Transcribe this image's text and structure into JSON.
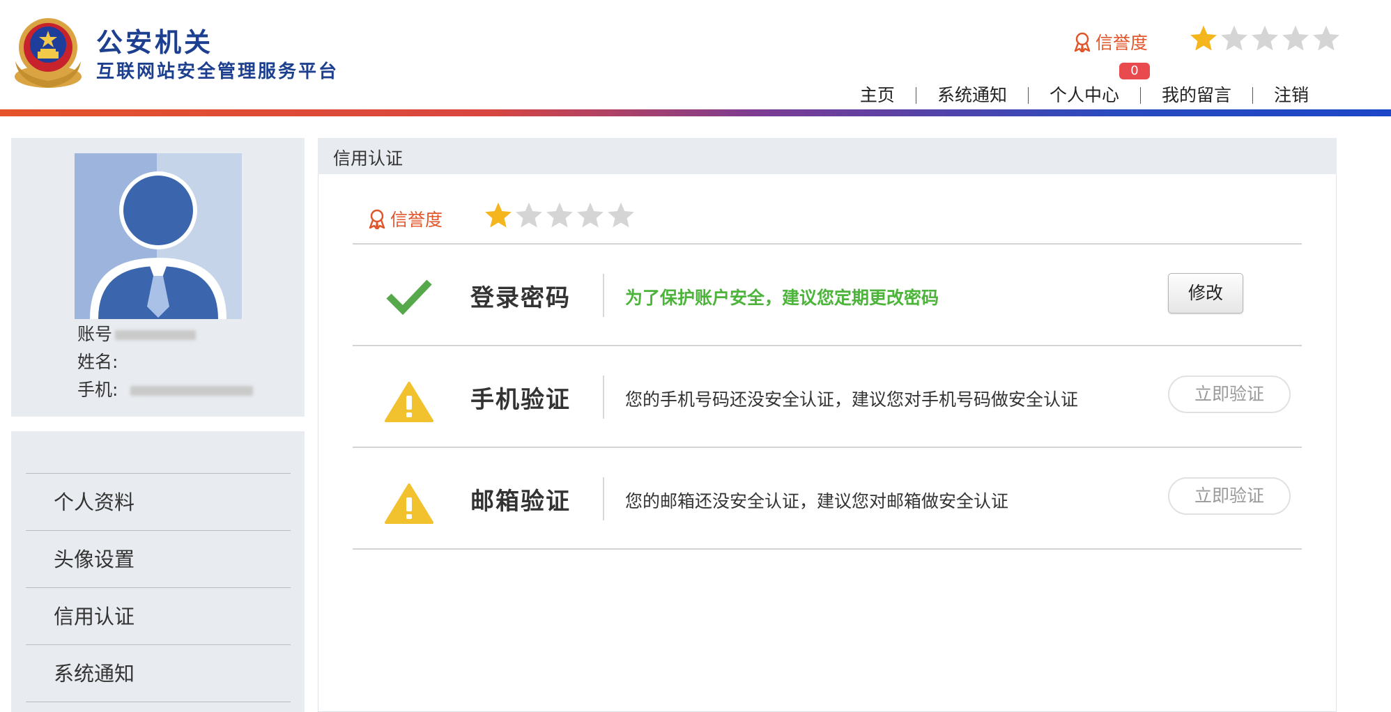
{
  "header": {
    "title": "公安机关",
    "subtitle": "互联网站安全管理服务平台",
    "reputation_label": "信誉度",
    "rating": 1,
    "rating_max": 5,
    "notification_count": "0",
    "nav": [
      "主页",
      "系统通知",
      "个人中心",
      "我的留言",
      "注销"
    ]
  },
  "profile": {
    "account_label": "账号",
    "name_label": "姓名:",
    "phone_label": "手机:"
  },
  "sidebar": {
    "items": [
      "个人资料",
      "头像设置",
      "信用认证",
      "系统通知"
    ]
  },
  "main": {
    "title": "信用认证",
    "reputation_label": "信誉度",
    "rating": 1,
    "rows": [
      {
        "icon": "check-icon",
        "name": "登录密码",
        "desc": "为了保护账户安全，建议您定期更改密码",
        "button": "修改"
      },
      {
        "icon": "warning-icon",
        "name": "手机验证",
        "desc": "您的手机号码还没安全认证，建议您对手机号码做安全认证",
        "button": "立即验证"
      },
      {
        "icon": "warning-icon",
        "name": "邮箱验证",
        "desc": "您的邮箱还没安全认证，建议您对邮箱做安全认证",
        "button": "立即验证"
      }
    ]
  },
  "colors": {
    "brand_blue": "#1d3f8f",
    "reputation_orange": "#e0562a",
    "star_gold": "#f5b51c",
    "success_green": "#4cb43a",
    "warning_yellow": "#f2c12e",
    "badge_red": "#e84a4e"
  }
}
